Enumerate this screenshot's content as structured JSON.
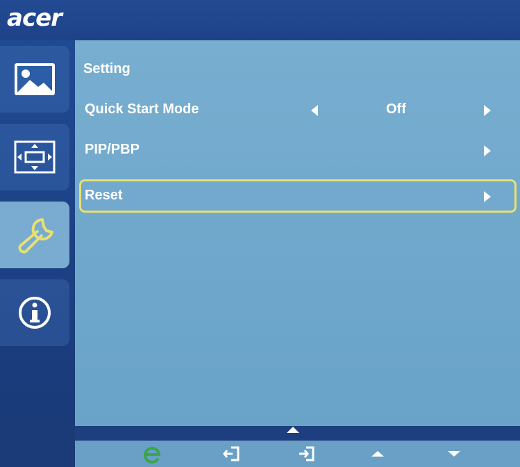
{
  "brand": {
    "logo_text": "acer"
  },
  "sidebar": {
    "tabs": [
      {
        "name": "picture",
        "icon": "picture-icon",
        "active": false
      },
      {
        "name": "osd",
        "icon": "osd-arrows-icon",
        "active": false
      },
      {
        "name": "setting",
        "icon": "wrench-icon",
        "active": true
      },
      {
        "name": "information",
        "icon": "info-icon",
        "active": false
      }
    ]
  },
  "panel": {
    "title": "Setting",
    "items": [
      {
        "label": "Quick Start Mode",
        "value": "Off"
      },
      {
        "label": "PIP/PBP"
      },
      {
        "label": "Reset"
      }
    ]
  },
  "footer": {
    "buttons": [
      "e-mode-icon",
      "exit-icon",
      "enter-icon",
      "up-icon",
      "down-icon"
    ]
  },
  "colors": {
    "panel": "#78aed0",
    "sidebar": "#1f4a92",
    "highlight": "#e8e070",
    "accent_green": "#3aa64a"
  }
}
